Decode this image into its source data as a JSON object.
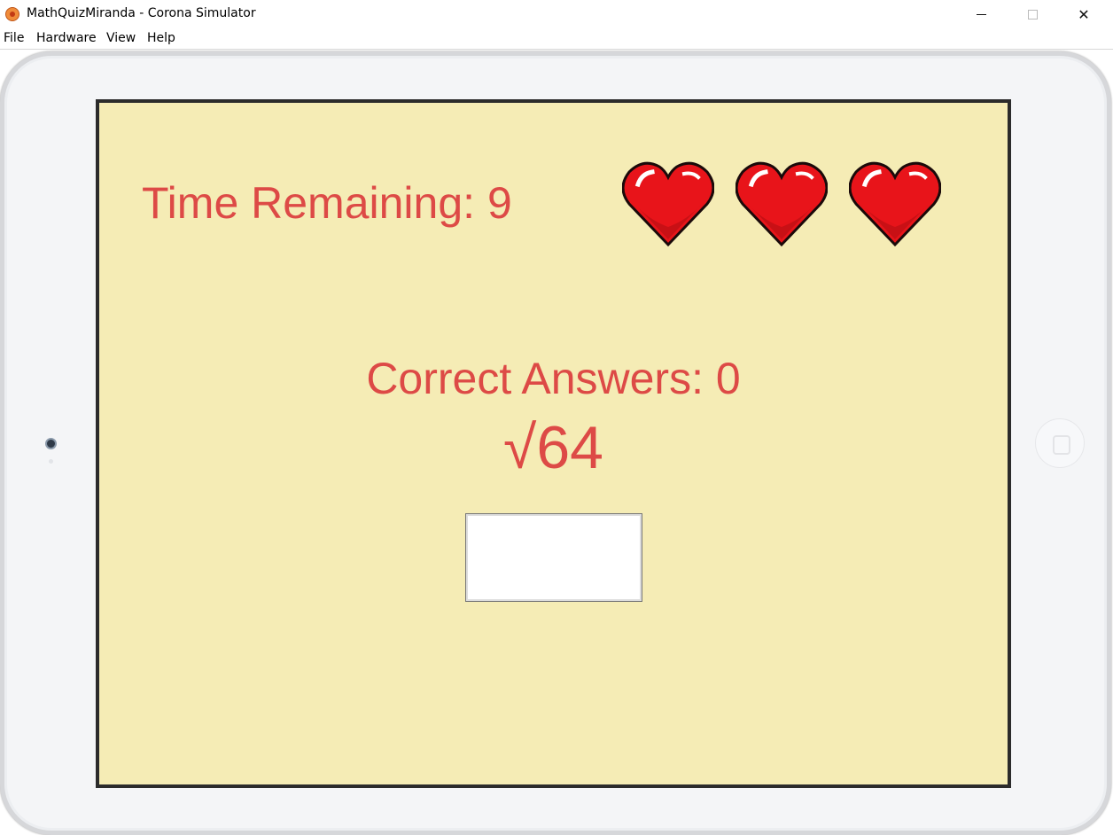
{
  "window": {
    "title": "MathQuizMiranda - Corona Simulator",
    "controls": {
      "minimize": "minimize-icon",
      "maximize": "maximize-icon",
      "close": "✕"
    }
  },
  "menu": {
    "items": [
      {
        "label": "File"
      },
      {
        "label": "Hardware"
      },
      {
        "label": "View"
      },
      {
        "label": "Help"
      }
    ]
  },
  "game": {
    "timer_text": "Time Remaining: 9",
    "lives": 3,
    "heart_icon": "heart-icon",
    "correct_text": "Correct Answers: 0",
    "question": "√64",
    "answer_value": ""
  },
  "colors": {
    "screen_background": "#f5ecb5",
    "text": "#dd4a46",
    "heart": "#e8141a"
  }
}
